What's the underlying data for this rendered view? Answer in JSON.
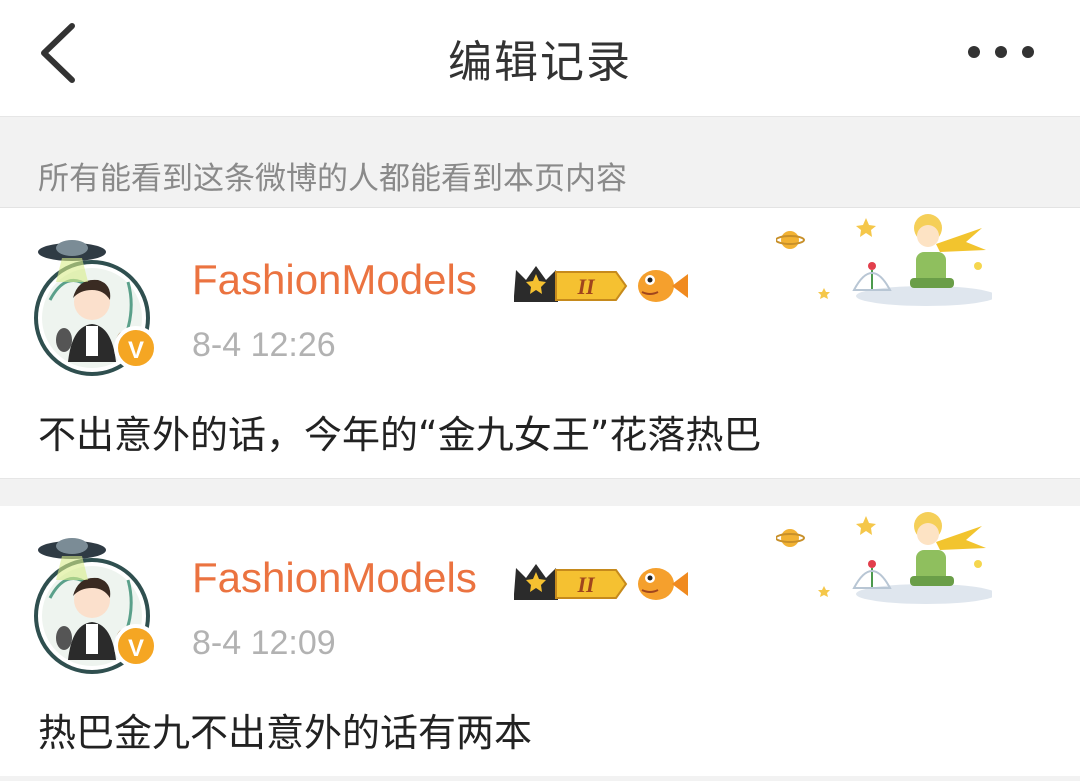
{
  "header": {
    "title": "编辑记录",
    "back_icon": "chevron-left-icon",
    "more_icon": "more-horizontal-icon"
  },
  "notice": {
    "text": "所有能看到这条微博的人都能看到本页内容"
  },
  "posts": [
    {
      "username": "FashionModels",
      "timestamp": "8-4 12:26",
      "text": "不出意外的话，今年的“金九女王”花落热巴",
      "verified_badge": "V",
      "level_badge": "II"
    },
    {
      "username": "FashionModels",
      "timestamp": "8-4 12:09",
      "text": "热巴金九不出意外的话有两本",
      "verified_badge": "V",
      "level_badge": "II"
    }
  ],
  "colors": {
    "username": "#eb7340",
    "timestamp": "#b2b2b2",
    "notice_bg": "#f2f2f2",
    "verified_badge": "#f5a623"
  }
}
